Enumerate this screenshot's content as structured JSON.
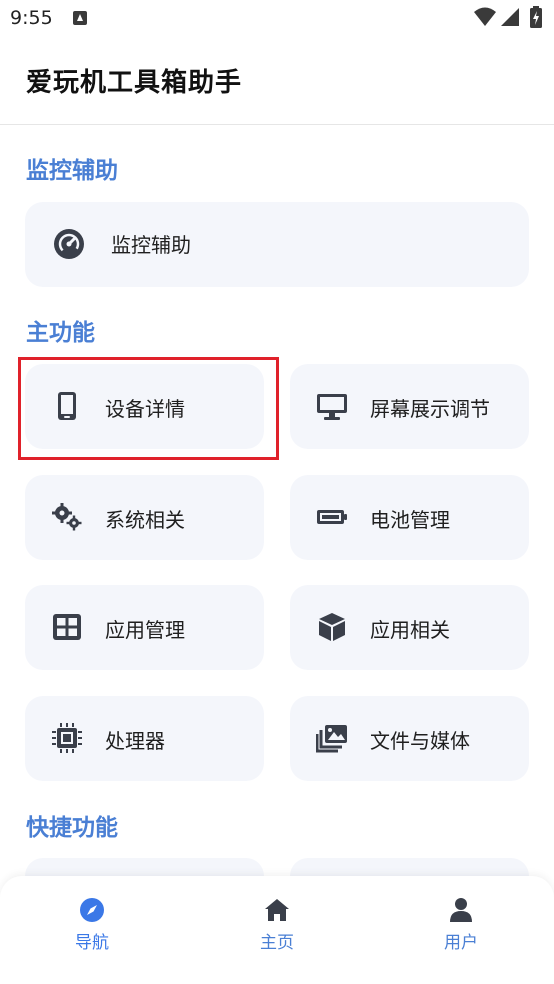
{
  "status_bar": {
    "time": "9:55",
    "icons": [
      "notification-icon",
      "wifi-icon",
      "cellular-icon",
      "battery-icon"
    ]
  },
  "app_bar": {
    "title": "爱玩机工具箱助手"
  },
  "sections": {
    "monitor": {
      "title": "监控辅助",
      "item": {
        "label": "监控辅助",
        "icon": "gauge-icon"
      }
    },
    "main_features": {
      "title": "主功能",
      "items": [
        {
          "label": "设备详情",
          "icon": "phone-icon",
          "highlighted": true
        },
        {
          "label": "屏幕展示调节",
          "icon": "monitor-icon"
        },
        {
          "label": "系统相关",
          "icon": "gears-icon"
        },
        {
          "label": "电池管理",
          "icon": "battery-icon"
        },
        {
          "label": "应用管理",
          "icon": "grid-icon"
        },
        {
          "label": "应用相关",
          "icon": "cube-icon"
        },
        {
          "label": "处理器",
          "icon": "cpu-icon"
        },
        {
          "label": "文件与媒体",
          "icon": "images-icon"
        }
      ]
    },
    "shortcuts": {
      "title": "快捷功能"
    }
  },
  "bottom_nav": {
    "items": [
      {
        "label": "导航",
        "icon": "compass-icon",
        "active": true
      },
      {
        "label": "主页",
        "icon": "home-icon",
        "active": false
      },
      {
        "label": "用户",
        "icon": "user-icon",
        "active": false
      }
    ]
  },
  "colors": {
    "accent": "#4a7fd4",
    "card_bg": "#f4f6fb",
    "icon": "#3a3f4a",
    "highlight": "#e0212a",
    "nav_inactive": "#4a7fd4"
  }
}
